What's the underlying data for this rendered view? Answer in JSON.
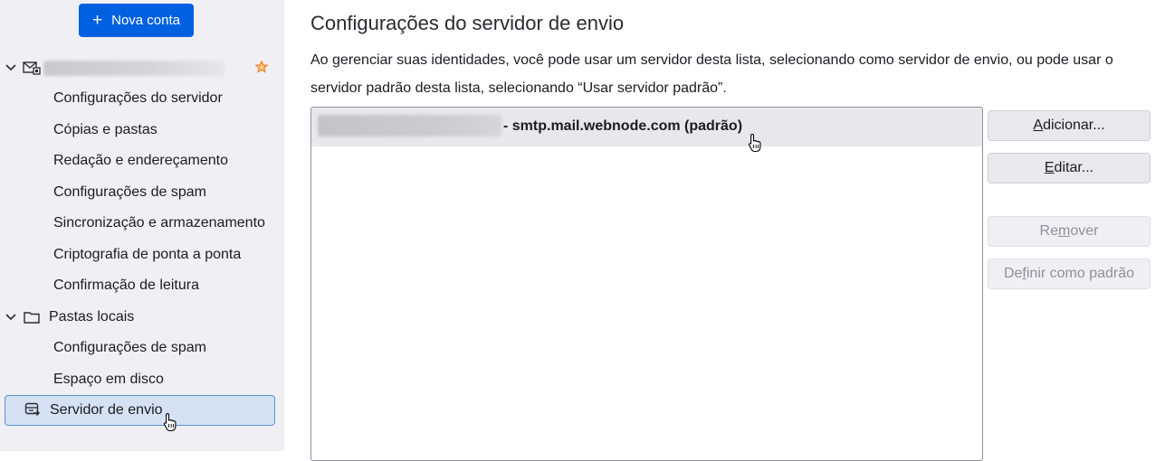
{
  "sidebar": {
    "new_account_label": "Nova conta",
    "account": {
      "name_redacted": true,
      "children": [
        "Configurações do servidor",
        "Cópias e pastas",
        "Redação e endereçamento",
        "Configurações de spam",
        "Sincronização e armazenamento",
        "Criptografia de ponta a ponta",
        "Confirmação de leitura"
      ]
    },
    "local_folders": {
      "label": "Pastas locais",
      "children": [
        "Configurações de spam",
        "Espaço em disco"
      ]
    },
    "outgoing_server_label": "Servidor de envio"
  },
  "main": {
    "title": "Configurações do servidor de envio",
    "description": "Ao gerenciar suas identidades, você pode usar um servidor desta lista, selecionando como servidor de envio, ou pode usar o servidor padrão desta lista, selecionando “Usar servidor padrão”.",
    "servers": [
      {
        "text": "- smtp.mail.webnode.com (padrão)"
      }
    ],
    "buttons": {
      "add": {
        "label": "Adicionar...",
        "accesskey": "A",
        "enabled": true
      },
      "edit": {
        "label": "Editar...",
        "accesskey": "E",
        "enabled": true
      },
      "remove": {
        "label": "Remover",
        "accesskey": "m",
        "enabled": false
      },
      "set_default": {
        "label": "Definir como padrão",
        "accesskey": "f",
        "enabled": false
      }
    }
  },
  "colors": {
    "accent": "#0061e0",
    "sidebar_bg": "#f0f0f4",
    "selection_bg": "#d4e2f3",
    "selection_border": "#5a94db",
    "star": "#f57b1e"
  }
}
